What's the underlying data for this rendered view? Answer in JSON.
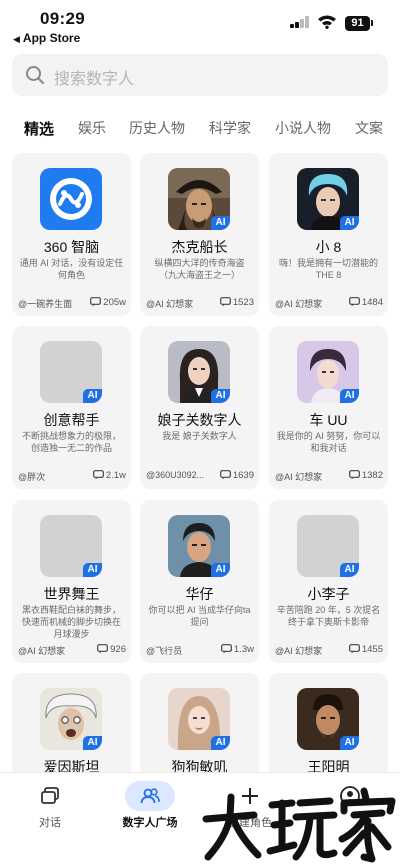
{
  "status": {
    "time": "09:29",
    "back_app": "App Store",
    "battery": "91"
  },
  "search": {
    "placeholder": "搜索数字人",
    "icon": "search-icon"
  },
  "tabs": [
    "精选",
    "娱乐",
    "历史人物",
    "科学家",
    "小说人物",
    "文案"
  ],
  "active_tab": "精选",
  "ai_badge": "AI",
  "cards": [
    {
      "name": "360 智脑",
      "desc": "通用 AI 对话，没有设定任何角色",
      "author": "@一碗养生面",
      "count": "205w"
    },
    {
      "name": "杰克船长",
      "desc": "纵横四大洋的传奇海盗（九大海盗王之一）",
      "author": "@AI 幻想家",
      "count": "1523"
    },
    {
      "name": "小 8",
      "desc": "嗨！我是拥有一切潜能的 THE 8",
      "author": "@AI 幻想家",
      "count": "1484"
    },
    {
      "name": "创意帮手",
      "desc": "不断挑战想象力的极限，创造独一无二的作品",
      "author": "@胖次",
      "count": "2.1w"
    },
    {
      "name": "娘子关数字人",
      "desc": "我是 娘子关数字人",
      "author": "@360U3092...",
      "count": "1639"
    },
    {
      "name": "车 UU",
      "desc": "我是你的 AI 努努，你可以和我对话",
      "author": "@AI 幻想家",
      "count": "1382"
    },
    {
      "name": "世界舞王",
      "desc": "黑衣西鞋配白袜的舞步，快速而机械的脚步切换在月球漫步",
      "author": "@AI 幻想家",
      "count": "926"
    },
    {
      "name": "华仔",
      "desc": "你可以把 AI 当成华仔向ta 提问",
      "author": "@飞行员",
      "count": "1.3w"
    },
    {
      "name": "小李子",
      "desc": "辛苦陪跑 20 年，5 次提名终于拿下奥斯卡影帝",
      "author": "@AI 幻想家",
      "count": "1455"
    },
    {
      "name": "爱因斯坦",
      "desc": "",
      "author": "",
      "count": ""
    },
    {
      "name": "狗狗敏叽",
      "desc": "",
      "author": "",
      "count": ""
    },
    {
      "name": "王阳明",
      "desc": "",
      "author": "",
      "count": ""
    }
  ],
  "bottom_nav": [
    {
      "label": "对话",
      "icon": "chat-icon"
    },
    {
      "label": "数字人广场",
      "icon": "people-icon"
    },
    {
      "label": "创建角色",
      "icon": "plus-icon"
    },
    {
      "label": "",
      "icon": "profile-icon"
    }
  ],
  "watermark_text": "大玩家",
  "colors": {
    "accent": "#1f6fe5",
    "nav_pill": "#dbe8ff",
    "card_bg": "#f4f4f5"
  }
}
